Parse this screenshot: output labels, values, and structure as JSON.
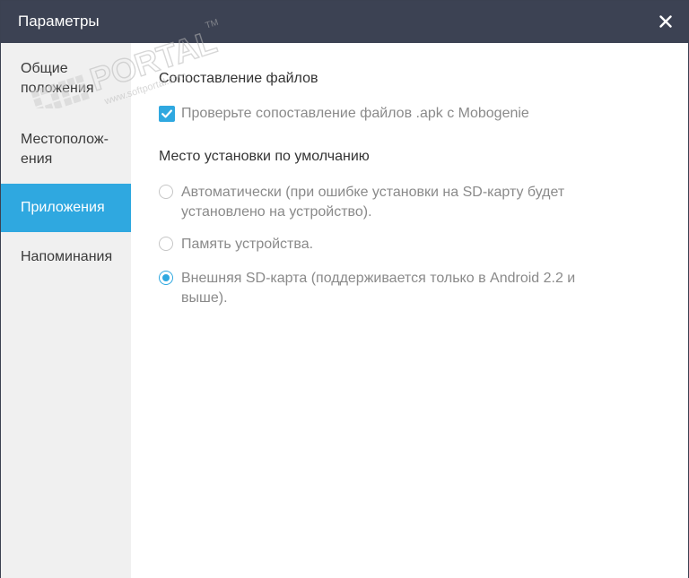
{
  "window": {
    "title": "Параметры"
  },
  "sidebar": {
    "items": [
      {
        "line1": "Общие",
        "line2": "положения",
        "active": false
      },
      {
        "line1": "Местополож-",
        "line2": "ения",
        "active": false
      },
      {
        "line1": "Приложения",
        "line2": "",
        "active": true
      },
      {
        "line1": "Напоминания",
        "line2": "",
        "active": false
      }
    ]
  },
  "content": {
    "file_assoc": {
      "title": "Сопоставление файлов",
      "checkbox_label": "Проверьте сопоставление файлов .apk с Mobogenie",
      "checked": true
    },
    "install_location": {
      "title": "Место установки по умолчанию",
      "options": [
        {
          "line1": "Автоматически (при ошибке установки на SD-карту будет",
          "line2": "установлено на устройство).",
          "selected": false
        },
        {
          "line1": "Память устройства.",
          "line2": "",
          "selected": false
        },
        {
          "line1": "Внешняя SD-карта (поддерживается только в Android 2.2 и",
          "line2": "выше).",
          "selected": true
        }
      ]
    }
  },
  "watermark": {
    "brand": "PORTAL",
    "url": "www.softportal.com",
    "tm": "TM"
  },
  "colors": {
    "titlebar": "#3c4253",
    "accent": "#2fa8e0",
    "sidebar": "#f0f0f0"
  },
  "icons": {
    "close": "close-icon",
    "check": "check-icon"
  }
}
